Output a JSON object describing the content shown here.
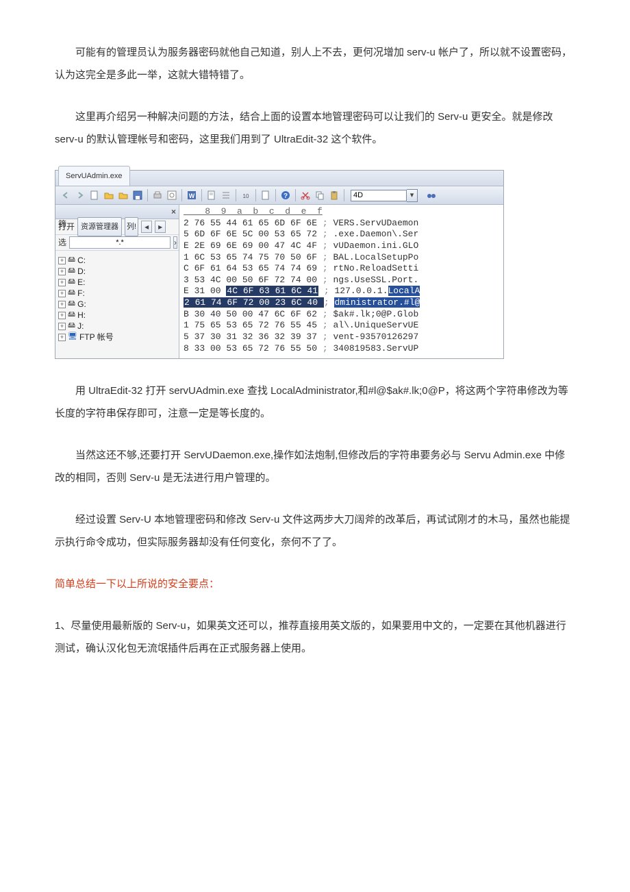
{
  "paragraphs": {
    "p1": "可能有的管理员认为服务器密码就他自己知道，别人上不去，更何况增加 serv-u 帐户了，所以就不设置密码，认为这完全是多此一举，这就大错特错了。",
    "p2": "这里再介绍另一种解决问题的方法，结合上面的设置本地管理密码可以让我们的 Serv-u 更安全。就是修改 serv-u 的默认管理帐号和密码，这里我们用到了 UltraEdit-32 这个软件。",
    "p3": "用 UltraEdit-32 打开 servUAdmin.exe 查找 LocalAdministrator,和#l@$ak#.lk;0@P，将这两个字符串修改为等长度的字符串保存即可，注意一定是等长度的。",
    "p4": "当然这还不够,还要打开 ServUDaemon.exe,操作如法炮制,但修改后的字符串要务必与 Servu Admin.exe 中修改的相同，否则 Serv-u 是无法进行用户管理的。",
    "p5": "经过设置 Serv-U 本地管理密码和修改 Serv-u 文件这两步大刀阔斧的改革后，再试试刚才的木马，虽然也能提示执行命令成功，但实际服务器却没有任何变化，奈何不了了。",
    "p6": "简单总结一下以上所说的安全要点：",
    "p7": "1、尽量使用最新版的 Serv-u，如果英文还可以，推荐直接用英文版的，如果要用中文的，一定要在其他机器进行测试，确认汉化包无流氓插件后再在正式服务器上使用。"
  },
  "ui": {
    "tab_title": "ServUAdmin.exe",
    "search_value": "4D",
    "left": {
      "open_label": "打开",
      "explorer_label": "资源管理器",
      "list_label": "列!",
      "filter_label": "筛选 :",
      "filter_value": "*.*",
      "drives": [
        "C:",
        "D:",
        "E:",
        "F:",
        "G:",
        "H:",
        "J:"
      ],
      "ftp_label": "FTP 帐号"
    },
    "hex": {
      "header": "    8  9  a  b  c  d  e  f",
      "lines": [
        {
          "o": "2",
          "h": "76 55 44 61 65 6D 6F 6E",
          "t": "VERS.ServUDaemon"
        },
        {
          "o": "5",
          "h": "6D 6F 6E 5C 00 53 65 72",
          "t": ".exe.Daemon\\.Ser"
        },
        {
          "o": "E",
          "h": "2E 69 6E 69 00 47 4C 4F",
          "t": "vUDaemon.ini.GLO"
        },
        {
          "o": "1",
          "h": "6C 53 65 74 75 70 50 6F",
          "t": "BAL.LocalSetupPo"
        },
        {
          "o": "C",
          "h": "6F 61 64 53 65 74 74 69",
          "t": "rtNo.ReloadSetti"
        },
        {
          "o": "3",
          "h": "53 4C 00 50 6F 72 74 00",
          "t": "ngs.UseSSL.Port."
        },
        {
          "o": "E",
          "h": "31 00",
          "h2": "4C 6F 63 61 6C 41",
          "t": "127.0.0.1.",
          "t2": "LocalA"
        },
        {
          "o": "2",
          "h": "61 74 6F 72",
          "h2": "00 23 6C 40",
          "t": "dministrator",
          "t2": ".#l@",
          "full_hl": true
        },
        {
          "o": "B",
          "h": "30 40 50 00 47 6C 6F 62",
          "t": "$ak#.lk;0@P.Glob"
        },
        {
          "o": "1",
          "h": "75 65 53 65 72 76 55 45",
          "t": "al\\.UniqueServUE"
        },
        {
          "o": "5",
          "h": "37 30 31 32 36 32 39 37",
          "t": "vent-93570126297"
        },
        {
          "o": "8",
          "h": "33 00 53 65 72 76 55 50",
          "t": "340819583.ServUP"
        }
      ]
    }
  }
}
